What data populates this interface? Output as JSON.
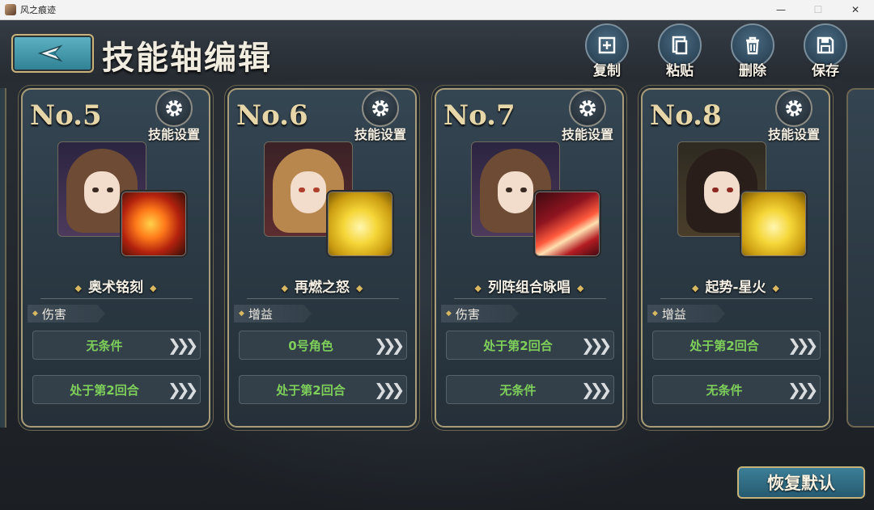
{
  "window": {
    "title": "风之痕迹",
    "minimize": "—",
    "maximize": "☐",
    "close": "✕"
  },
  "header": {
    "title": "技能轴编辑"
  },
  "toolbar": {
    "copy": "复制",
    "paste": "粘贴",
    "delete": "删除",
    "save": "保存"
  },
  "colors": {
    "condition_text": "#7ecf5a",
    "card_border": "#a99c78",
    "gold": "#d8b860"
  },
  "cards": [
    {
      "no": "No.5",
      "settings_label": "技能设置",
      "skill_name": "奥术铭刻",
      "type": "伤害",
      "conditions": [
        "无条件",
        "处于第2回合"
      ],
      "portrait": "witch-girl-portrait",
      "skill_icon": "fireball-icon"
    },
    {
      "no": "No.6",
      "settings_label": "技能设置",
      "skill_name": "再燃之怒",
      "type": "增益",
      "conditions": [
        "0号角色",
        "处于第2回合"
      ],
      "portrait": "hooded-boy-portrait",
      "skill_icon": "golden-warrior-icon"
    },
    {
      "no": "No.7",
      "settings_label": "技能设置",
      "skill_name": "列阵组合咏唱",
      "type": "伤害",
      "conditions": [
        "处于第2回合",
        "无条件"
      ],
      "portrait": "witch-girl-portrait",
      "skill_icon": "red-beam-icon"
    },
    {
      "no": "No.8",
      "settings_label": "技能设置",
      "skill_name": "起势-星火",
      "type": "增益",
      "conditions": [
        "处于第2回合",
        "无条件"
      ],
      "portrait": "dark-haired-girl-portrait",
      "skill_icon": "golden-warrior-icon"
    }
  ],
  "footer": {
    "reset_label": "恢复默认"
  }
}
